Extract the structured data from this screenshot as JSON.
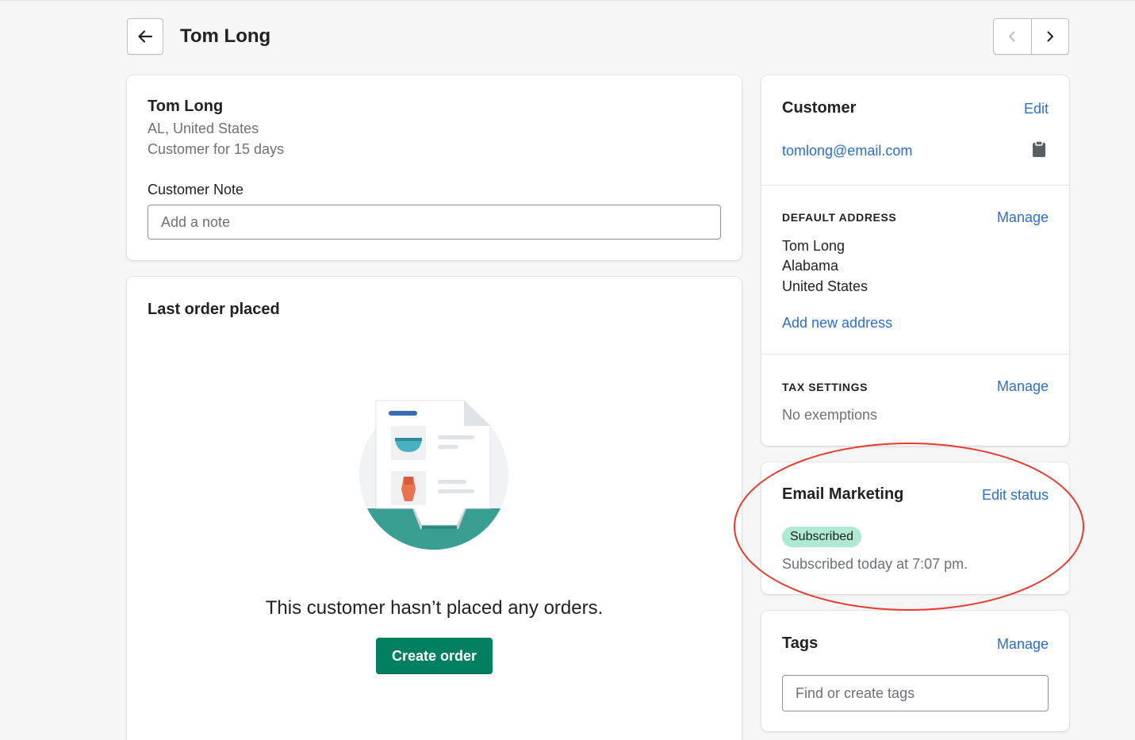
{
  "header": {
    "title": "Tom Long",
    "back_label": "Back",
    "prev_label": "Previous customer",
    "next_label": "Next customer"
  },
  "summary": {
    "name": "Tom Long",
    "location": "AL, United States",
    "customer_since": "Customer for 15 days",
    "note_label": "Customer Note",
    "note_placeholder": "Add a note",
    "note_value": ""
  },
  "last_order": {
    "title": "Last order placed",
    "empty_message": "This customer hasn’t placed any orders.",
    "create_button": "Create order"
  },
  "customer": {
    "title": "Customer",
    "edit_label": "Edit",
    "email": "tomlong@email.com",
    "copy_icon": "clipboard-icon",
    "default_address": {
      "title": "DEFAULT ADDRESS",
      "manage_label": "Manage",
      "lines": [
        "Tom Long",
        "Alabama",
        "United States"
      ],
      "add_label": "Add new address"
    },
    "tax": {
      "title": "TAX SETTINGS",
      "manage_label": "Manage",
      "value": "No exemptions"
    }
  },
  "email_marketing": {
    "title": "Email Marketing",
    "edit_label": "Edit status",
    "badge": "Subscribed",
    "status_text": "Subscribed today at 7:07 pm."
  },
  "tags": {
    "title": "Tags",
    "manage_label": "Manage",
    "placeholder": "Find or create tags"
  },
  "colors": {
    "primary_button": "#008060",
    "link": "#2c6ecb",
    "badge_success": "#aee9d1",
    "annotation": "#e8392a",
    "background": "#f6f6f7"
  }
}
